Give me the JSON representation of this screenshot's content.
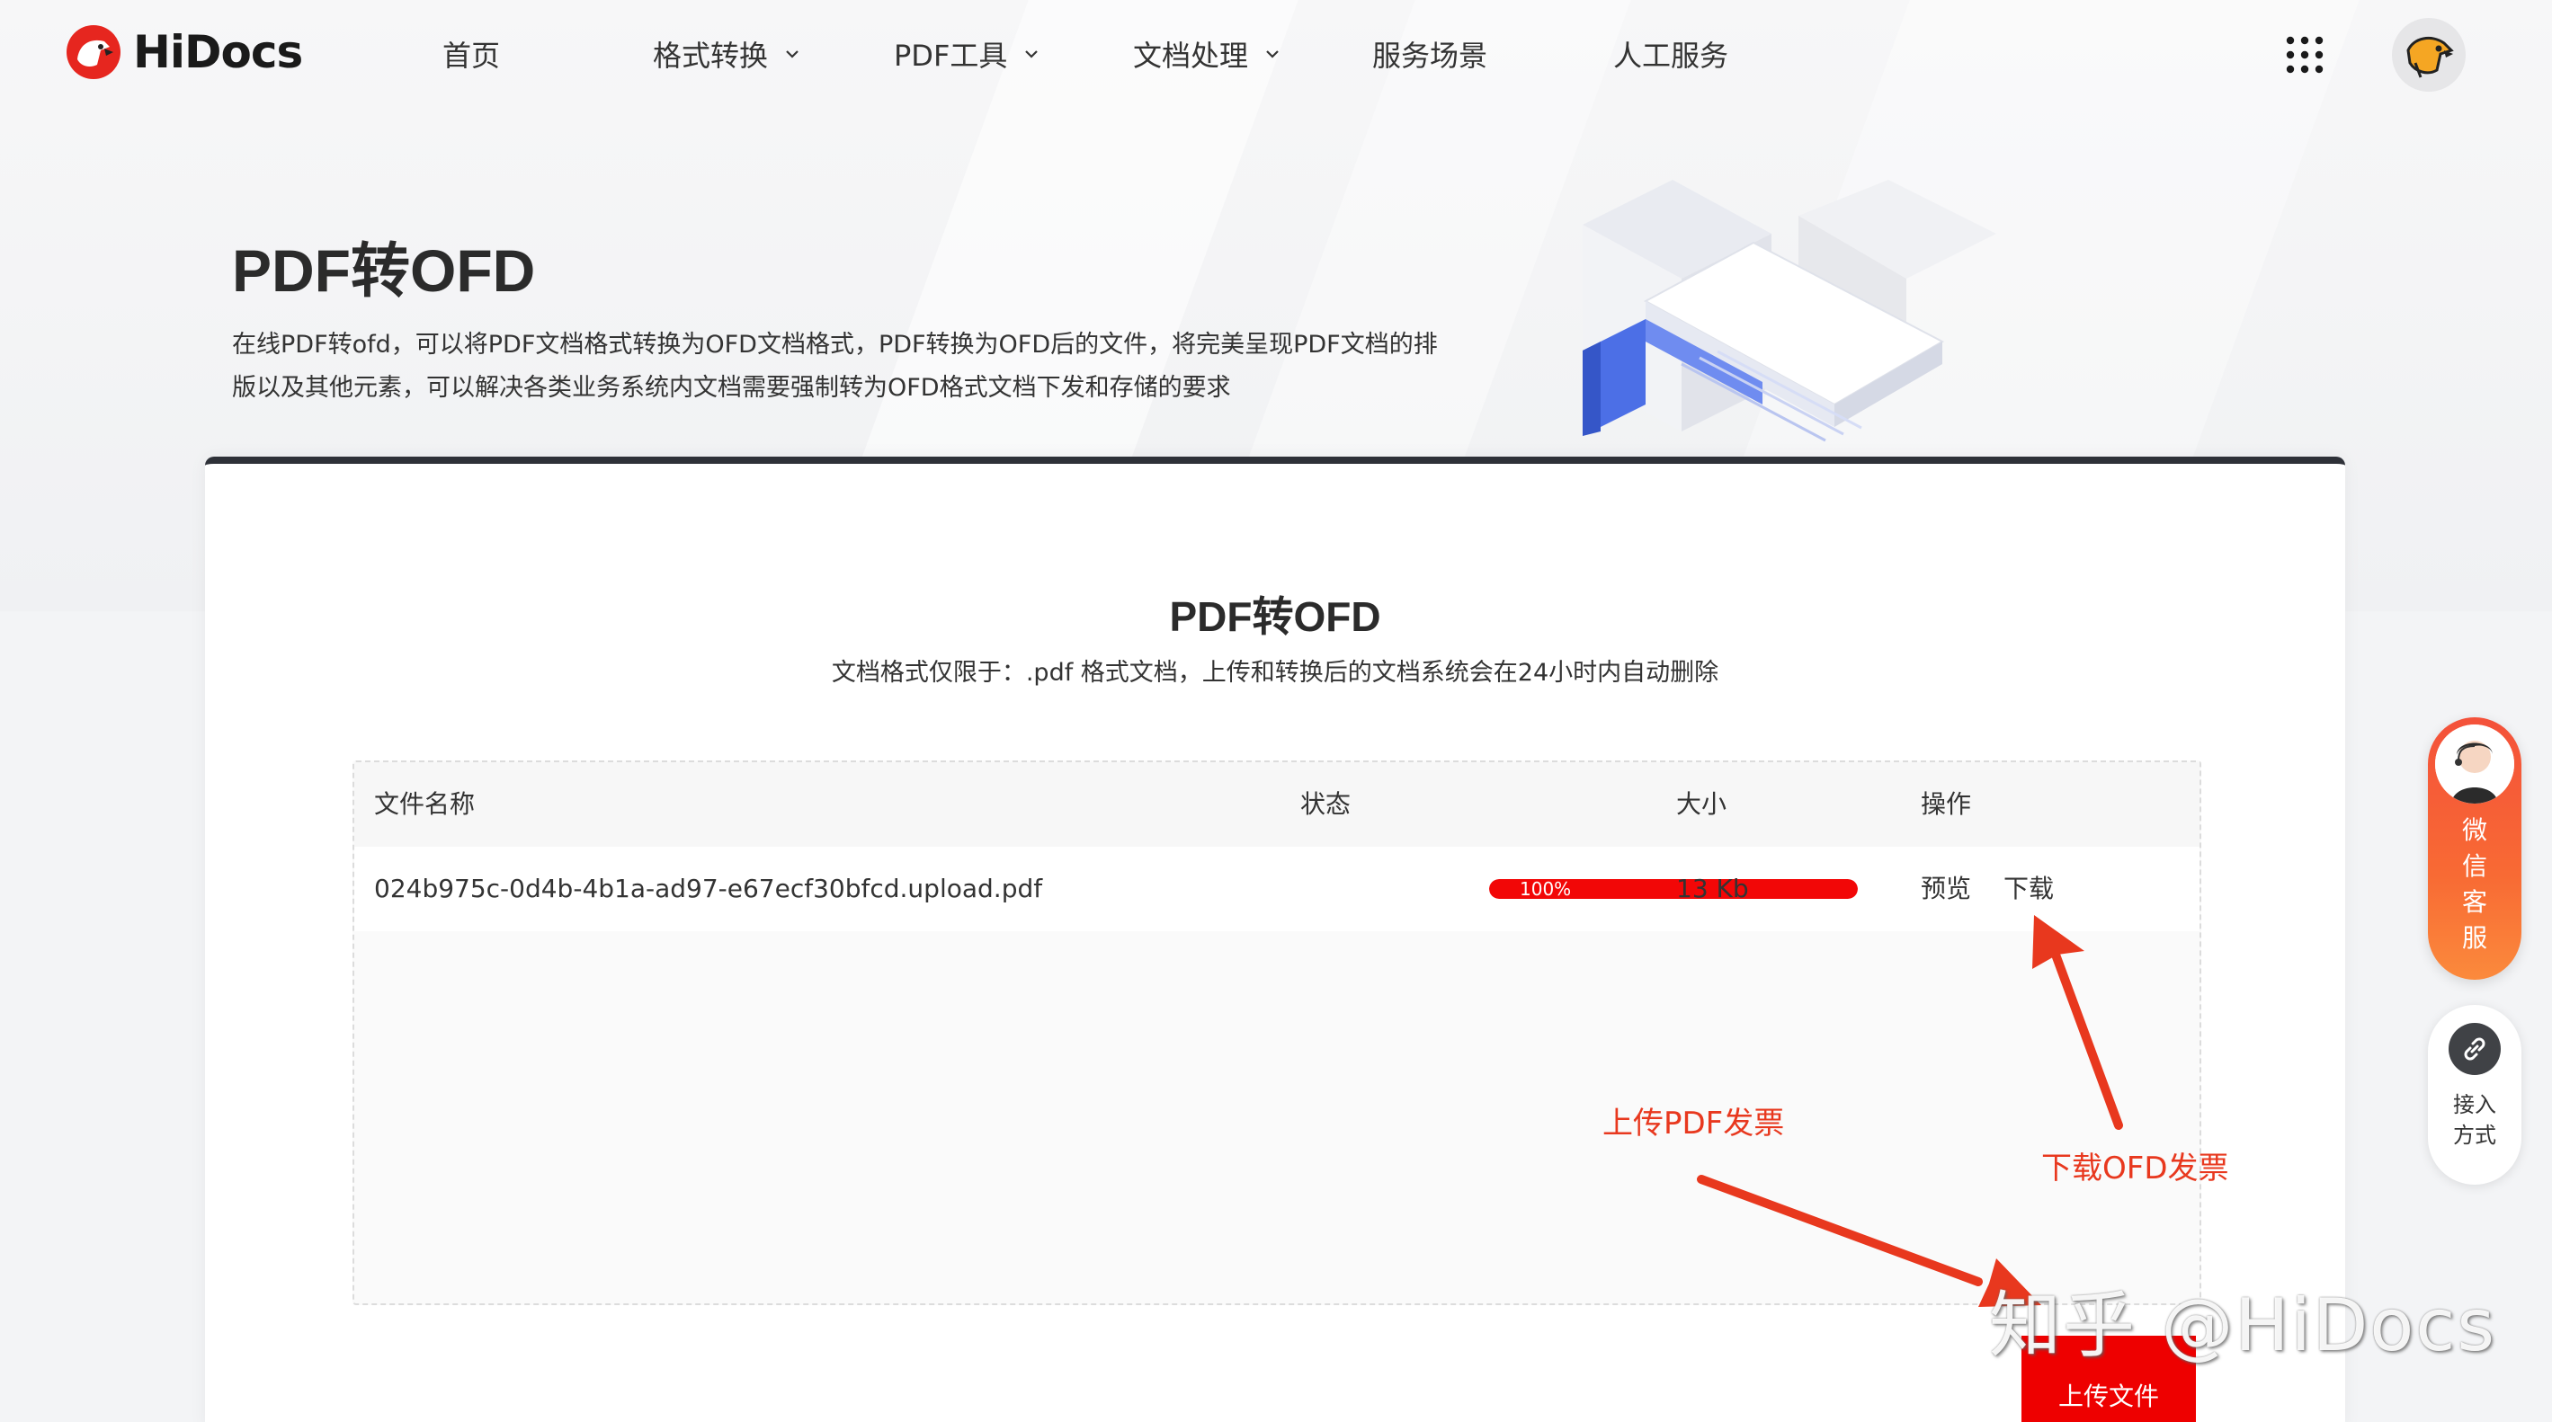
{
  "brand": {
    "name": "HiDocs",
    "accent": "#ee0000"
  },
  "nav": {
    "items": [
      {
        "label": "首页",
        "has_dropdown": false
      },
      {
        "label": "格式转换",
        "has_dropdown": true
      },
      {
        "label": "PDF工具",
        "has_dropdown": true
      },
      {
        "label": "文档处理",
        "has_dropdown": true
      },
      {
        "label": "服务场景",
        "has_dropdown": false
      },
      {
        "label": "人工服务",
        "has_dropdown": false
      }
    ],
    "apps_icon": "grid-dots-icon",
    "avatar_icon": "dog-avatar-icon"
  },
  "hero": {
    "title": "PDF转OFD",
    "desc_line1": "在线PDF转ofd，可以将PDF文档格式转换为OFD文档格式，PDF转换为OFD后的文件，将完美呈现PDF文档的排",
    "desc_line2": "版以及其他元素，可以解决各类业务系统内文档需要强制转为OFD格式文档下发和存储的要求"
  },
  "converter": {
    "title": "PDF转OFD",
    "subtitle": "文档格式仅限于：.pdf 格式文档，上传和转换后的文档系统会在24小时内自动删除",
    "columns": [
      "文件名称",
      "状态",
      "大小",
      "操作"
    ],
    "files": [
      {
        "name": "024b975c-0d4b-4b1a-ad97-e67ecf30bfcd.upload.pdf",
        "progress_percent": 100,
        "progress_label": "100%",
        "size": "13 Kb",
        "actions": [
          "预览",
          "下载"
        ]
      }
    ],
    "upload_button": "上传文件"
  },
  "annotations": {
    "upload": "上传PDF发票",
    "download": "下载OFD发票",
    "color": "#e8381e"
  },
  "watermark": "知乎 @HiDocs",
  "side_widgets": {
    "customer_service": "微信客服",
    "access": [
      "接入",
      "方式"
    ],
    "access_icon": "link-icon"
  }
}
